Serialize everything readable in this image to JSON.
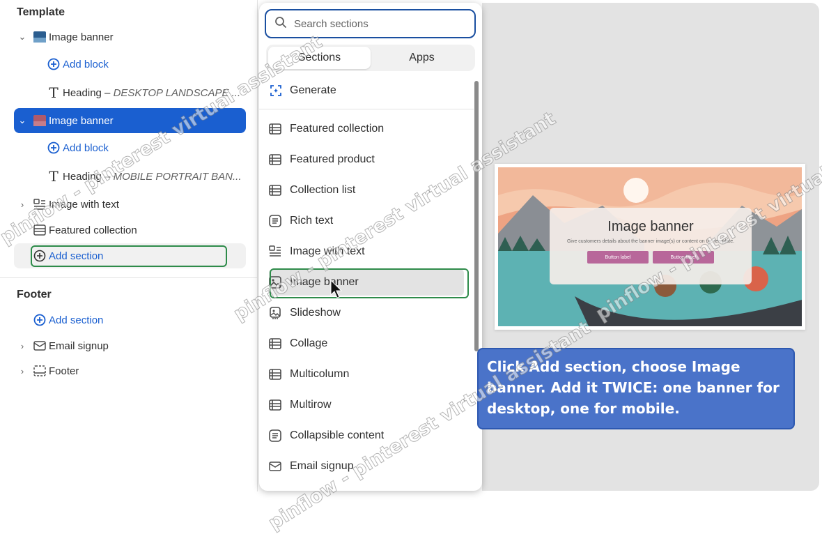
{
  "sidebar": {
    "template_title": "Template",
    "footer_title": "Footer",
    "template_items": [
      {
        "label": "Image banner"
      },
      {
        "label": "Add block"
      },
      {
        "label": "Heading",
        "detail": "DESKTOP LANDSCAPE ..."
      },
      {
        "label": "Image banner"
      },
      {
        "label": "Add block"
      },
      {
        "label": "Heading",
        "detail": "MOBILE PORTRAIT BAN..."
      },
      {
        "label": "Image with text"
      },
      {
        "label": "Featured collection"
      },
      {
        "label": "Add section"
      }
    ],
    "footer_items": [
      {
        "label": "Add section"
      },
      {
        "label": "Email signup"
      },
      {
        "label": "Footer"
      }
    ],
    "heading_dash": " – "
  },
  "popover": {
    "search_placeholder": "Search sections",
    "tabs": [
      "Sections",
      "Apps"
    ],
    "generate_label": "Generate",
    "items": [
      {
        "label": "Featured collection",
        "icon": "layout-list-icon"
      },
      {
        "label": "Featured product",
        "icon": "layout-list-icon"
      },
      {
        "label": "Collection list",
        "icon": "layout-list-icon"
      },
      {
        "label": "Rich text",
        "icon": "text-block-icon"
      },
      {
        "label": "Image with text",
        "icon": "image-with-text-icon"
      },
      {
        "label": "Image banner",
        "icon": "image-icon"
      },
      {
        "label": "Slideshow",
        "icon": "slideshow-icon"
      },
      {
        "label": "Collage",
        "icon": "layout-list-icon"
      },
      {
        "label": "Multicolumn",
        "icon": "layout-list-icon"
      },
      {
        "label": "Multirow",
        "icon": "layout-list-icon"
      },
      {
        "label": "Collapsible content",
        "icon": "text-block-icon"
      },
      {
        "label": "Email signup",
        "icon": "email-icon"
      }
    ]
  },
  "preview": {
    "banner_title": "Image banner",
    "banner_text": "Give customers details about the banner image(s) or content on the template.",
    "button_1": "Button label",
    "button_2": "Button label"
  },
  "callout": {
    "text": "Click Add section, choose Image banner. Add it TWICE: one banner for desktop, one for mobile."
  },
  "watermark": {
    "text": "pinflow - pinterest virtual assistant"
  },
  "colors": {
    "accent": "#1a5fd0",
    "highlight_outline": "#2e8b4a",
    "callout_bg": "#4a73c9"
  }
}
